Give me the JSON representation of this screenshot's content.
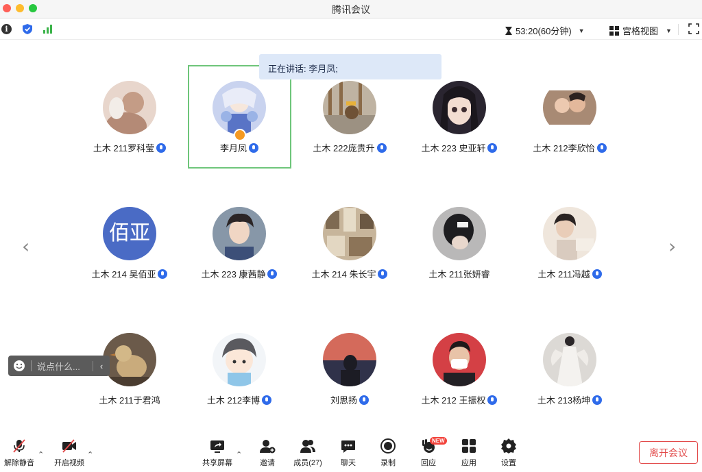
{
  "window": {
    "title": "腾讯会议"
  },
  "topbar": {
    "timer": "53:20(60分钟)",
    "view_label": "宫格视图"
  },
  "speaking": {
    "text": "正在讲话: 李月凤;"
  },
  "participants": [
    {
      "name": "土木 211罗科莹",
      "avatar_color": "#c9a596"
    },
    {
      "name": "李月凤",
      "avatar_color": "#b9c5e9",
      "host": true
    },
    {
      "name": "土木 222庞贵升",
      "avatar_color": "#a79a86"
    },
    {
      "name": "土木 223 史亚轩",
      "avatar_color": "#3d3440"
    },
    {
      "name": "土木 212李欣怡",
      "avatar_color": "#b38f7c"
    },
    {
      "name": "土木 214 吴佰亚",
      "avatar_text": "佰亚",
      "avatar_color": "#4a6bc5"
    },
    {
      "name": "土木 223 康茜静",
      "avatar_color": "#6f7d8f"
    },
    {
      "name": "土木 214 朱长宇",
      "avatar_color": "#8d7964"
    },
    {
      "name": "土木 211张妍睿",
      "avatar_color": "#494a4e"
    },
    {
      "name": "土木 211冯越",
      "avatar_color": "#e6ddd3"
    },
    {
      "name": "土木 211于君鸿",
      "avatar_color": "#8f7a5e"
    },
    {
      "name": "土木 212李博",
      "avatar_color": "#dfe6ee"
    },
    {
      "name": "刘思扬",
      "avatar_color": "#4c4a5e"
    },
    {
      "name": "土木 212 王振权",
      "avatar_color": "#d9474a"
    },
    {
      "name": "土木 213杨坤",
      "avatar_color": "#d8d4cf"
    }
  ],
  "chat": {
    "placeholder": "说点什么..."
  },
  "toolbar": {
    "unmute": "解除静音",
    "start_video": "开启视频",
    "share_screen": "共享屏幕",
    "invite": "邀请",
    "members": "成员(27)",
    "chat": "聊天",
    "record": "录制",
    "react": "回应",
    "new_badge": "NEW",
    "apps": "应用",
    "settings": "设置",
    "leave": "离开会议"
  },
  "colors": {
    "accent": "#2f6bea",
    "speaking_border": "#6ec57a",
    "leave": "#e24a4a"
  }
}
